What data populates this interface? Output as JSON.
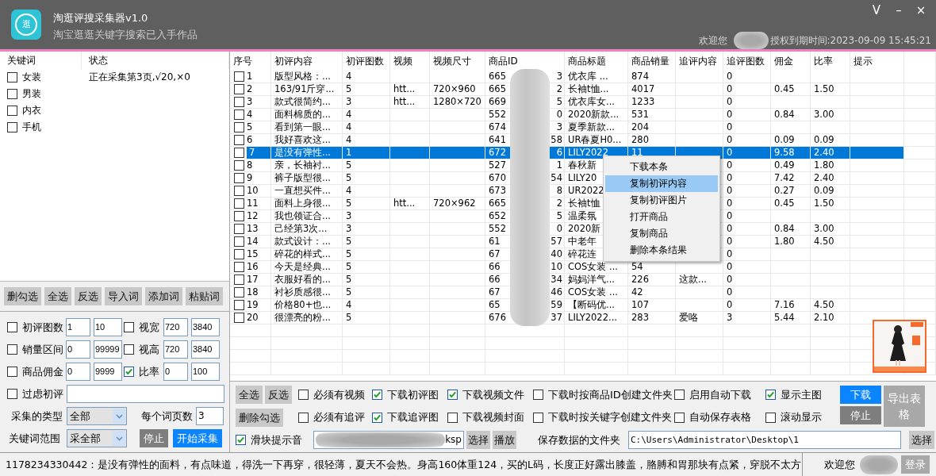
{
  "window": {
    "title": "淘逛评搜采集器v1.0",
    "subtitle": "淘宝逛逛关键字搜索已入手作品",
    "icon_char": "逛",
    "controls": [
      "V",
      "–",
      "×"
    ],
    "welcome": "欢迎您",
    "license": "授权到期时间:2023-09-09 15:45:21"
  },
  "keywords": {
    "columns": [
      "关键词",
      "状态"
    ],
    "items": [
      {
        "word": "女装",
        "checked": false,
        "status": "正在采集第3页,√20,×0"
      },
      {
        "word": "男装",
        "checked": false
      },
      {
        "word": "内衣",
        "checked": false
      },
      {
        "word": "手机",
        "checked": false
      }
    ]
  },
  "keyword_buttons": [
    "删勾选",
    "全选",
    "反选",
    "导入词",
    "添加词",
    "粘贴词"
  ],
  "filters": [
    {
      "label": "初评图数",
      "checked": false,
      "min": "1",
      "max": "10"
    },
    {
      "label": "视宽",
      "checked": false,
      "min": "720",
      "max": "3840"
    },
    {
      "label": "销量区间",
      "checked": false,
      "min": "0",
      "max": "99999"
    },
    {
      "label": "视高",
      "checked": false,
      "min": "720",
      "max": "3840"
    },
    {
      "label": "商品佣金",
      "checked": false,
      "min": "0",
      "max": "9999"
    },
    {
      "label": "比率",
      "checked": true,
      "min": "0",
      "max": "100"
    }
  ],
  "comment_filter": {
    "label": "过虑初评",
    "checked": false
  },
  "collect_type": {
    "label": "采集的类型",
    "value": "全部"
  },
  "pages_per_word": {
    "label": "每个词页数",
    "value": "3"
  },
  "keyword_scope": {
    "label": "关键词范围",
    "value": "采全部"
  },
  "collect_actions": [
    {
      "label": "停止",
      "kind": "dark"
    },
    {
      "label": "开始采集",
      "kind": "primary"
    }
  ],
  "table": {
    "columns": [
      "序号",
      "初评内容",
      "初评图数",
      "视频",
      "视频尺寸",
      "商品ID",
      "商品标题",
      "商品销量",
      "追评内容",
      "追评图数",
      "佣金",
      "比率",
      "提示"
    ],
    "rows": [
      {
        "no": "1",
        "checked": false,
        "selected": false,
        "comment": "版型风格：...",
        "images": "4",
        "id_start": "665",
        "id_end": "3",
        "title": "优衣库 ...",
        "sales": "874",
        "follow_images": "0"
      },
      {
        "no": "2",
        "checked": false,
        "selected": false,
        "comment": "163/91斤穿...",
        "images": "5",
        "video": "htt...",
        "video_size": "720×960",
        "id_start": "665",
        "id_end": "2",
        "title": "长袖t恤...",
        "sales": "4017",
        "follow_images": "0",
        "commission": "0.45",
        "rate": "1.50"
      },
      {
        "no": "3",
        "checked": false,
        "selected": false,
        "comment": "款式很简约...",
        "images": "3",
        "video": "htt...",
        "video_size": "1280×720",
        "id_start": "669",
        "id_end": "5",
        "title": "优衣库女...",
        "sales": "1233",
        "follow_images": "0"
      },
      {
        "no": "4",
        "checked": false,
        "selected": false,
        "comment": "面料棉质的...",
        "images": "4",
        "id_start": "552",
        "id_end": "0",
        "title": "2020新款...",
        "sales": "531",
        "follow_images": "0",
        "commission": "0.84",
        "rate": "3.00"
      },
      {
        "no": "5",
        "checked": false,
        "selected": false,
        "comment": "看到第一眼...",
        "images": "4",
        "id_start": "674",
        "id_end": "3",
        "title": "夏季新款...",
        "sales": "204",
        "follow_images": "0"
      },
      {
        "no": "6",
        "checked": false,
        "selected": false,
        "comment": "我好喜欢这...",
        "images": "4",
        "id_start": "641",
        "id_end": "58",
        "title": "UR春夏H0...",
        "sales": "280",
        "follow_images": "0",
        "commission": "0.09",
        "rate": "0.09"
      },
      {
        "no": "7",
        "checked": false,
        "selected": true,
        "comment": "是没有弹性...",
        "images": "1",
        "id_start": "672",
        "id_end": "6",
        "title": "LILY2022",
        "sales": "11",
        "follow_images": "0",
        "commission": "9.58",
        "rate": "2.40"
      },
      {
        "no": "8",
        "checked": false,
        "selected": false,
        "comment": "亲，长袖衬...",
        "images": "5",
        "id_start": "527",
        "id_end": "1",
        "title": "春秋新",
        "follow_images": "0",
        "commission": "0.49",
        "rate": "1.80"
      },
      {
        "no": "9",
        "checked": false,
        "selected": false,
        "comment": "裤子版型很...",
        "images": "5",
        "id_start": "670",
        "id_end": "54",
        "title": "LILY20",
        "follow_images": "0",
        "commission": "7.42",
        "rate": "2.40"
      },
      {
        "no": "10",
        "checked": false,
        "selected": false,
        "comment": "一直想买件...",
        "images": "4",
        "id_start": "673",
        "id_end": "8",
        "title": "UR2022",
        "follow_images": "0",
        "commission": "0.27",
        "rate": "0.09"
      },
      {
        "no": "11",
        "checked": false,
        "selected": false,
        "comment": "面料上身很...",
        "images": "5",
        "video": "htt...",
        "video_size": "720×962",
        "id_start": "665",
        "id_end": "2",
        "title": "长袖t恤",
        "follow_images": "0",
        "commission": "0.45",
        "rate": "1.50"
      },
      {
        "no": "12",
        "checked": false,
        "selected": false,
        "comment": "我也领证合...",
        "images": "3",
        "id_start": "652",
        "id_end": "5",
        "title": "温柔氛",
        "follow_images": "0"
      },
      {
        "no": "13",
        "checked": false,
        "selected": false,
        "comment": "己经第3次...",
        "images": "3",
        "id_start": "552",
        "id_end": "0",
        "title": "2020新",
        "follow_images": "0",
        "commission": "0.84",
        "rate": "3.00"
      },
      {
        "no": "14",
        "checked": false,
        "selected": false,
        "comment": "款式设计：...",
        "images": "5",
        "id_start": "61",
        "id_end": "57",
        "title": "中老年",
        "follow_images": "0",
        "commission": "1.80",
        "rate": "4.50"
      },
      {
        "no": "15",
        "checked": false,
        "selected": false,
        "comment": "碎花的样式...",
        "images": "5",
        "id_start": "67",
        "id_end": "40",
        "title": "碎花连",
        "follow_images": "0"
      },
      {
        "no": "16",
        "checked": false,
        "selected": false,
        "comment": "今天是经典...",
        "images": "5",
        "id_start": "66",
        "id_end": "10",
        "title": "COS女装 ...",
        "sales": "54",
        "follow_images": "0"
      },
      {
        "no": "17",
        "checked": false,
        "selected": false,
        "comment": "衣服好看的...",
        "images": "5",
        "id_start": "66",
        "id_end": "34",
        "title": "妈妈洋气...",
        "sales": "226",
        "follow_comment": "这款...",
        "follow_images": "0"
      },
      {
        "no": "18",
        "checked": false,
        "selected": false,
        "comment": "衬衫质感很...",
        "images": "5",
        "id_start": "67",
        "id_end": "46",
        "title": "COS女装 ...",
        "sales": "42",
        "follow_images": "0"
      },
      {
        "no": "19",
        "checked": false,
        "selected": false,
        "comment": "价格80+也...",
        "images": "4",
        "id_start": "65",
        "id_end": "59",
        "title": "【断码优...",
        "sales": "107",
        "follow_images": "0",
        "commission": "7.16",
        "rate": "4.50"
      },
      {
        "no": "20",
        "checked": false,
        "selected": false,
        "comment": "很漂亮的粉...",
        "images": "5",
        "id_start": "676",
        "id_end": "37",
        "title": "LILY2022...",
        "sales": "283",
        "follow_comment": "爱咯",
        "follow_images": "3",
        "commission": "5.44",
        "rate": "2.10"
      }
    ]
  },
  "context_menu": {
    "items": [
      {
        "label": "下载本条",
        "selected": false
      },
      {
        "label": "复制初评内容",
        "selected": true
      },
      {
        "label": "复制初评图片",
        "selected": false
      },
      {
        "label": "打开商品",
        "selected": false
      },
      {
        "label": "复制商品",
        "selected": false
      },
      {
        "label": "删除本条结果",
        "selected": false
      }
    ]
  },
  "bottom": {
    "row1_buttons": [
      "全选",
      "反选"
    ],
    "row2_buttons": [
      "删除勾选"
    ],
    "options": [
      {
        "label": "必须有视频",
        "checked": false
      },
      {
        "label": "下载初评图",
        "checked": true
      },
      {
        "label": "下载视频文件",
        "checked": true
      },
      {
        "label": "下载时按商品ID创建文件夹",
        "checked": false
      },
      {
        "label": "启用自动下载",
        "checked": false
      },
      {
        "label": "显示主图",
        "checked": true
      },
      {
        "label": "必须有追评",
        "checked": false
      },
      {
        "label": "下载追评图",
        "checked": true
      },
      {
        "label": "下载视频封面",
        "checked": false
      },
      {
        "label": "下载时按关键字创建文件夹",
        "checked": false
      },
      {
        "label": "自动保存表格",
        "checked": false
      },
      {
        "label": "滚动显示",
        "checked": false
      }
    ],
    "actions": [
      {
        "label": "下载",
        "kind": "primary"
      },
      {
        "label": "停止",
        "kind": "dark"
      },
      {
        "label": "导出表格",
        "kind": "muted"
      }
    ],
    "sound": {
      "label": "滑块提示音",
      "checked": true,
      "value_tail": "ksp",
      "buttons": [
        "选择",
        "播放"
      ]
    },
    "save_folder": {
      "label": "保存数据的文件夹",
      "path": "C:\\Users\\Administrator\\Desktop\\1",
      "button": "选择"
    }
  },
  "status_bar": {
    "message": "1178234330442：是没有弹性的面料，有点味道，得洗一下再穿，很轻薄，夏天不会热。身高160体重124，买的L码，长度正好露出膝盖，胳膊和胃那块有点紧，穿脱不太方",
    "welcome": "欢迎您",
    "login": "登录"
  }
}
